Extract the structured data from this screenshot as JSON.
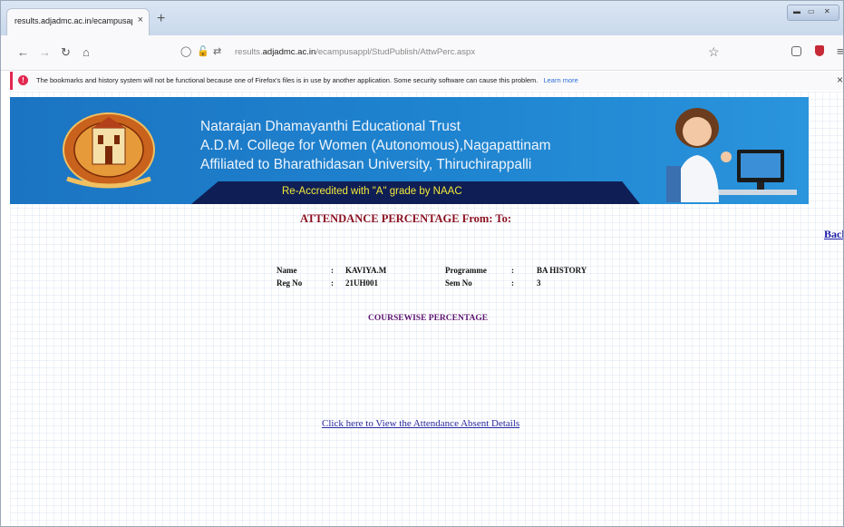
{
  "browser": {
    "tab_title": "results.adjadmc.ac.in/ecampusappl",
    "tab_close": "×",
    "new_tab": "+",
    "url_prefix": "results.",
    "url_domain": "adjadmc.ac.in",
    "url_path": "/ecampusappl/StudPublish/AttwPerc.aspx"
  },
  "notification": {
    "text": "The bookmarks and history system will not be functional because one of Firefox's files is in use by another application. Some security software can cause this problem.",
    "link": "Learn more",
    "icon": "!",
    "close": "×"
  },
  "banner": {
    "line1": "Natarajan Dhamayanthi Educational Trust",
    "line2": "A.D.M. College for Women (Autonomous),Nagapattinam",
    "line3": "Affiliated to Bharathidasan University, Thiruchirappalli",
    "accreditation": "Re-Accredited with \"A\" grade by NAAC"
  },
  "page": {
    "title": "ATTENDANCE PERCENTAGE From:   To:",
    "back_link": "Back"
  },
  "student": {
    "name_label": "Name",
    "name_value": "KAVIYA.M",
    "regno_label": "Reg No",
    "regno_value": "21UH001",
    "programme_label": "Programme",
    "programme_value": "BA HISTORY",
    "semno_label": "Sem No",
    "semno_value": "3",
    "separator": ":"
  },
  "coursewise_heading": "COURSEWISE PERCENTAGE",
  "absent_link": "Click here to View the Attendance Absent Details",
  "colors": {
    "banner_blue": "#1f84d0",
    "title_red": "#8b0f1f",
    "accreditation_yellow": "#f3e93a",
    "link_blue": "#2a2aa0"
  }
}
